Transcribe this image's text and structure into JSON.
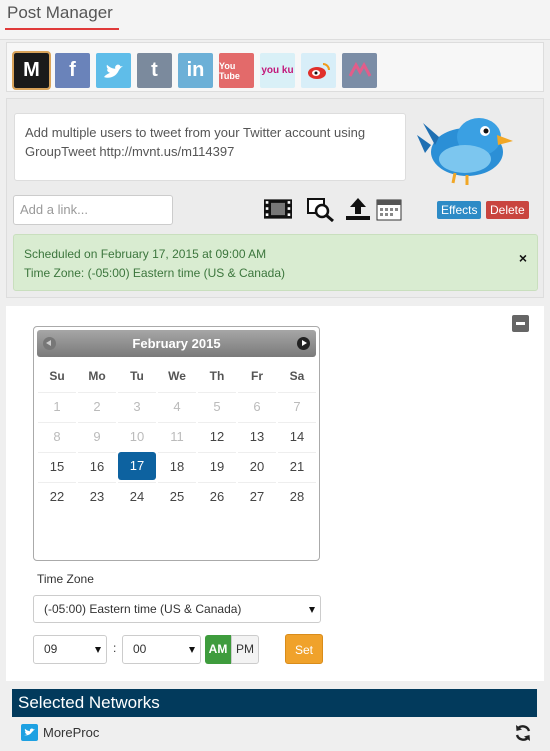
{
  "header": {
    "title": "Post Manager"
  },
  "networks": [
    {
      "icon": "msn-icon",
      "label": "M",
      "color": "#1a1a1a",
      "active": true
    },
    {
      "icon": "facebook-icon",
      "label": "f",
      "color": "#6a83ba"
    },
    {
      "icon": "twitter-icon",
      "label": "",
      "color": "#5fbde9"
    },
    {
      "icon": "tumblr-icon",
      "label": "t",
      "color": "#7b8a9d"
    },
    {
      "icon": "linkedin-icon",
      "label": "in",
      "color": "#6cb0d7"
    },
    {
      "icon": "youtube-icon",
      "label": "You Tube",
      "color": "#e36a6a"
    },
    {
      "icon": "youku-icon",
      "label": "you ku",
      "color": "#d9f0f7"
    },
    {
      "icon": "weibo-icon",
      "label": "",
      "color": "#d8eef8"
    },
    {
      "icon": "mastodon-like-icon",
      "label": "",
      "color": "#7b8da6"
    }
  ],
  "composer": {
    "message": "Add multiple users to tweet from your Twitter account using GroupTweet http://mvnt.us/m114397",
    "link_placeholder": "Add a link...",
    "effects_label": "Effects",
    "delete_label": "Delete"
  },
  "schedule": {
    "line1": "Scheduled on February 17, 2015 at 09:00 AM",
    "line2": "Time Zone: (-05:00) Eastern time (US & Canada)",
    "close": "×"
  },
  "calendar": {
    "month_label": "February 2015",
    "weekdays": [
      "Su",
      "Mo",
      "Tu",
      "We",
      "Th",
      "Fr",
      "Sa"
    ],
    "weeks": [
      [
        {
          "d": "1",
          "m": true
        },
        {
          "d": "2",
          "m": true
        },
        {
          "d": "3",
          "m": true
        },
        {
          "d": "4",
          "m": true
        },
        {
          "d": "5",
          "m": true
        },
        {
          "d": "6",
          "m": true
        },
        {
          "d": "7",
          "m": true
        }
      ],
      [
        {
          "d": "8",
          "m": true
        },
        {
          "d": "9",
          "m": true
        },
        {
          "d": "10",
          "m": true
        },
        {
          "d": "11",
          "m": true
        },
        {
          "d": "12"
        },
        {
          "d": "13"
        },
        {
          "d": "14"
        }
      ],
      [
        {
          "d": "15"
        },
        {
          "d": "16"
        },
        {
          "d": "17",
          "sel": true
        },
        {
          "d": "18"
        },
        {
          "d": "19"
        },
        {
          "d": "20"
        },
        {
          "d": "21"
        }
      ],
      [
        {
          "d": "22"
        },
        {
          "d": "23"
        },
        {
          "d": "24"
        },
        {
          "d": "25"
        },
        {
          "d": "26"
        },
        {
          "d": "27"
        },
        {
          "d": "28"
        }
      ]
    ]
  },
  "timezone": {
    "label": "Time Zone",
    "selected": "(-05:00) Eastern time (US & Canada)"
  },
  "time": {
    "hour": "09",
    "separator": ":",
    "minute": "00",
    "am": "AM",
    "pm": "PM",
    "set_label": "Set"
  },
  "selected_networks": {
    "title": "Selected Networks",
    "items": [
      {
        "name": "MoreProc"
      }
    ]
  }
}
